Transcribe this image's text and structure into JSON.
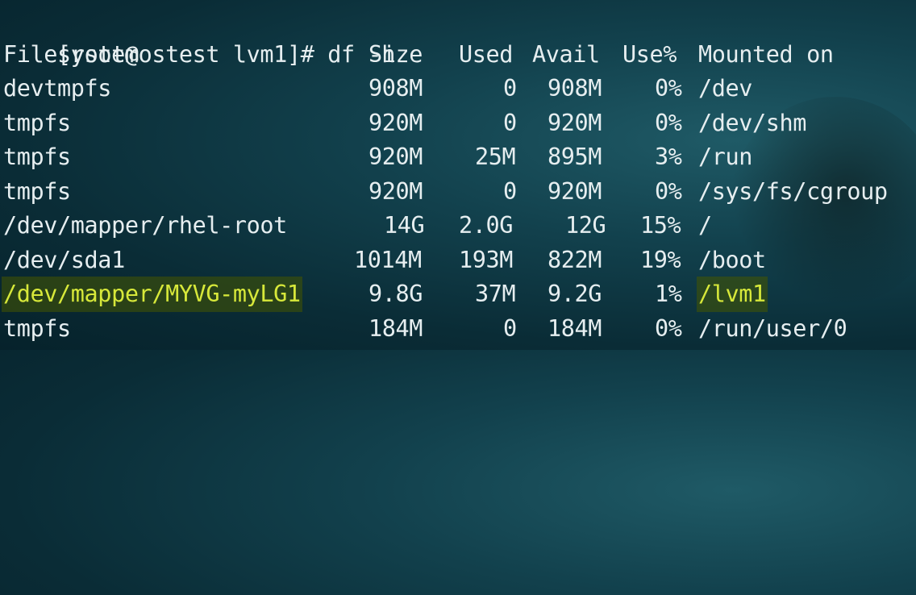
{
  "prompt": "[root@ostest lvm1]# df -h",
  "headers": [
    "Filesystem",
    "Size",
    "Used",
    "Avail",
    "Use%",
    "Mounted on"
  ],
  "rows": [
    [
      "devtmpfs",
      "908M",
      "0",
      "908M",
      "0%",
      "/dev"
    ],
    [
      "tmpfs",
      "920M",
      "0",
      "920M",
      "0%",
      "/dev/shm"
    ],
    [
      "tmpfs",
      "920M",
      "25M",
      "895M",
      "3%",
      "/run"
    ],
    [
      "tmpfs",
      "920M",
      "0",
      "920M",
      "0%",
      "/sys/fs/cgroup"
    ],
    [
      "/dev/mapper/rhel-root",
      "14G",
      "2.0G",
      "12G",
      "15%",
      "/"
    ],
    [
      "/dev/sda1",
      "1014M",
      "193M",
      "822M",
      "19%",
      "/boot"
    ],
    [
      "/dev/mapper/MYVG-myLG1",
      "9.8G",
      "37M",
      "9.2G",
      "1%",
      "/lvm1"
    ],
    [
      "tmpfs",
      "184M",
      "0",
      "184M",
      "0%",
      "/run/user/0"
    ]
  ],
  "highlight_color": "#d7e83a"
}
